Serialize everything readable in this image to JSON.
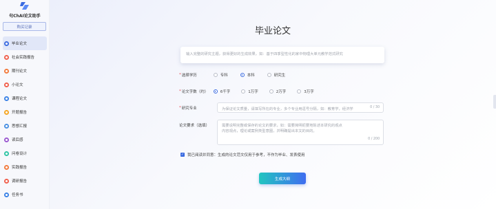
{
  "app": {
    "logo_text": "句ChAI论文助手"
  },
  "sidebar": {
    "buy_label": "购买记录",
    "items": [
      {
        "label": "毕业论文",
        "color": "#3b6be0",
        "active": true
      },
      {
        "label": "社会实践报告",
        "color": "#f0604d",
        "active": false
      },
      {
        "label": "期刊论文",
        "color": "#f27b3d",
        "active": false
      },
      {
        "label": "小论文",
        "color": "#f0604d",
        "active": false
      },
      {
        "label": "课程论文",
        "color": "#3b82e6",
        "active": false
      },
      {
        "label": "开题报告",
        "color": "#f5a623",
        "active": false
      },
      {
        "label": "思想汇报",
        "color": "#4a90e2",
        "active": false
      },
      {
        "label": "读后感",
        "color": "#9b59d0",
        "active": false
      },
      {
        "label": "问卷设计",
        "color": "#2ec4a4",
        "active": false
      },
      {
        "label": "实践报告",
        "color": "#f27b3d",
        "active": false
      },
      {
        "label": "调研报告",
        "color": "#f0604d",
        "active": false
      },
      {
        "label": "任务书",
        "color": "#3b82e6",
        "active": false
      }
    ]
  },
  "main": {
    "title": "毕业论文",
    "topic_placeholder": "输入完整的研究主题，获得更好的生成效果，如：基于四季型性化的家中物理大单元教学范式研究",
    "education": {
      "label": "选择学历",
      "options": [
        "专科",
        "本科",
        "研究生"
      ],
      "selected": "本科"
    },
    "word_count": {
      "label": "论文字数（约）",
      "options": [
        "6千字",
        "1万字",
        "2万字",
        "3万字"
      ],
      "selected": "6千字"
    },
    "major": {
      "label": "研究专业",
      "placeholder": "为保证论文质量，请填写所在的专业，多个专业用逗号分隔，如：教育学，经济学",
      "count": "0 / 30"
    },
    "requirements": {
      "label": "论文要求（选填）",
      "placeholder": "需要说明完整或保存的论文的要求，如：需要简明扼要地陈述本研究的观点内容观点，理论或案例类型意图，并明确提出本文的目的。",
      "count": "0 / 200"
    },
    "agree_text": "我已阅读并同意：生成的论文范文仅用于参考，不作为毕业、发表使用",
    "generate_label": "生成大纲"
  }
}
